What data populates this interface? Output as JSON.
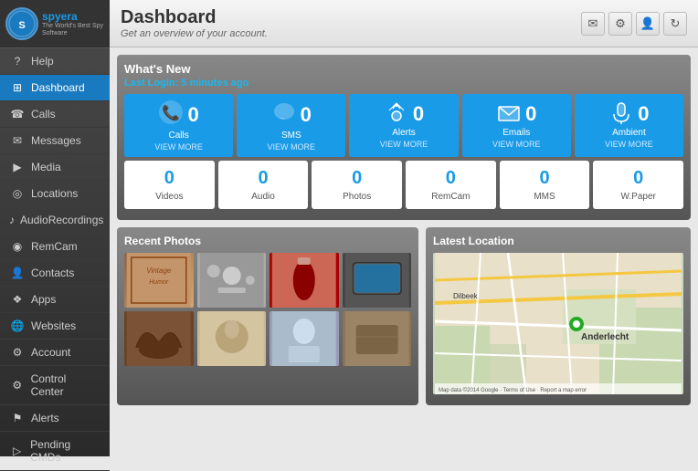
{
  "app": {
    "name": "spyera",
    "tagline": "The World's Best Spy Software"
  },
  "sidebar": {
    "items": [
      {
        "id": "help",
        "label": "Help",
        "icon": "?"
      },
      {
        "id": "dashboard",
        "label": "Dashboard",
        "icon": "⊞",
        "active": true
      },
      {
        "id": "calls",
        "label": "Calls",
        "icon": "☎"
      },
      {
        "id": "messages",
        "label": "Messages",
        "icon": "✉"
      },
      {
        "id": "media",
        "label": "Media",
        "icon": "▶"
      },
      {
        "id": "locations",
        "label": "Locations",
        "icon": "◎"
      },
      {
        "id": "audiorecordings",
        "label": "AudioRecordings",
        "icon": "♪"
      },
      {
        "id": "remcam",
        "label": "RemCam",
        "icon": "◉"
      },
      {
        "id": "contacts",
        "label": "Contacts",
        "icon": "👤"
      },
      {
        "id": "apps",
        "label": "Apps",
        "icon": "❖"
      },
      {
        "id": "websites",
        "label": "Websites",
        "icon": "🌐"
      },
      {
        "id": "account",
        "label": "Account",
        "icon": "⚙"
      },
      {
        "id": "control-center",
        "label": "Control Center",
        "icon": "⚙"
      },
      {
        "id": "alerts",
        "label": "Alerts",
        "icon": "⚑"
      },
      {
        "id": "pending-cmds",
        "label": "Pending CMDs",
        "icon": "▷"
      }
    ]
  },
  "header": {
    "title": "Dashboard",
    "subtitle": "Get an overview of your account.",
    "icons": [
      "envelope-icon",
      "gear-icon",
      "user-icon",
      "refresh-icon"
    ]
  },
  "whats_new": {
    "title": "What's New",
    "last_login_label": "Last Login:",
    "last_login_value": "5 minutes ago",
    "stats_top": [
      {
        "label": "Calls",
        "value": "0",
        "icon": "📞",
        "viewmore": "VIEW MORE"
      },
      {
        "label": "SMS",
        "value": "0",
        "icon": "💬",
        "viewmore": "VIEW MORE"
      },
      {
        "label": "Alerts",
        "value": "0",
        "icon": "📡",
        "viewmore": "VIEW MORE"
      },
      {
        "label": "Emails",
        "value": "0",
        "icon": "✉",
        "viewmore": "VIEW MORE"
      },
      {
        "label": "Ambient",
        "value": "0",
        "icon": "🎤",
        "viewmore": "VIEW MORE"
      }
    ],
    "stats_bottom": [
      {
        "label": "Videos",
        "value": "0"
      },
      {
        "label": "Audio",
        "value": "0"
      },
      {
        "label": "Photos",
        "value": "0"
      },
      {
        "label": "RemCam",
        "value": "0"
      },
      {
        "label": "MMS",
        "value": "0"
      },
      {
        "label": "W.Paper",
        "value": "0"
      }
    ]
  },
  "recent_photos": {
    "title": "Recent Photos",
    "photos": [
      {
        "id": "p1",
        "alt": "Vintage"
      },
      {
        "id": "p2",
        "alt": "Tools"
      },
      {
        "id": "p3",
        "alt": "Bottle"
      },
      {
        "id": "p4",
        "alt": "Tablet"
      },
      {
        "id": "p5",
        "alt": "Bag"
      },
      {
        "id": "p6",
        "alt": "Old photo"
      },
      {
        "id": "p7",
        "alt": "Portrait"
      },
      {
        "id": "p8",
        "alt": "Brown"
      }
    ]
  },
  "latest_location": {
    "title": "Latest Location",
    "map_label": "Anderlecht",
    "map_sublabel": "Dilbeek",
    "copyright": "Map data ©2014 Google",
    "terms": "Terms of Use",
    "report": "Report a map error"
  }
}
